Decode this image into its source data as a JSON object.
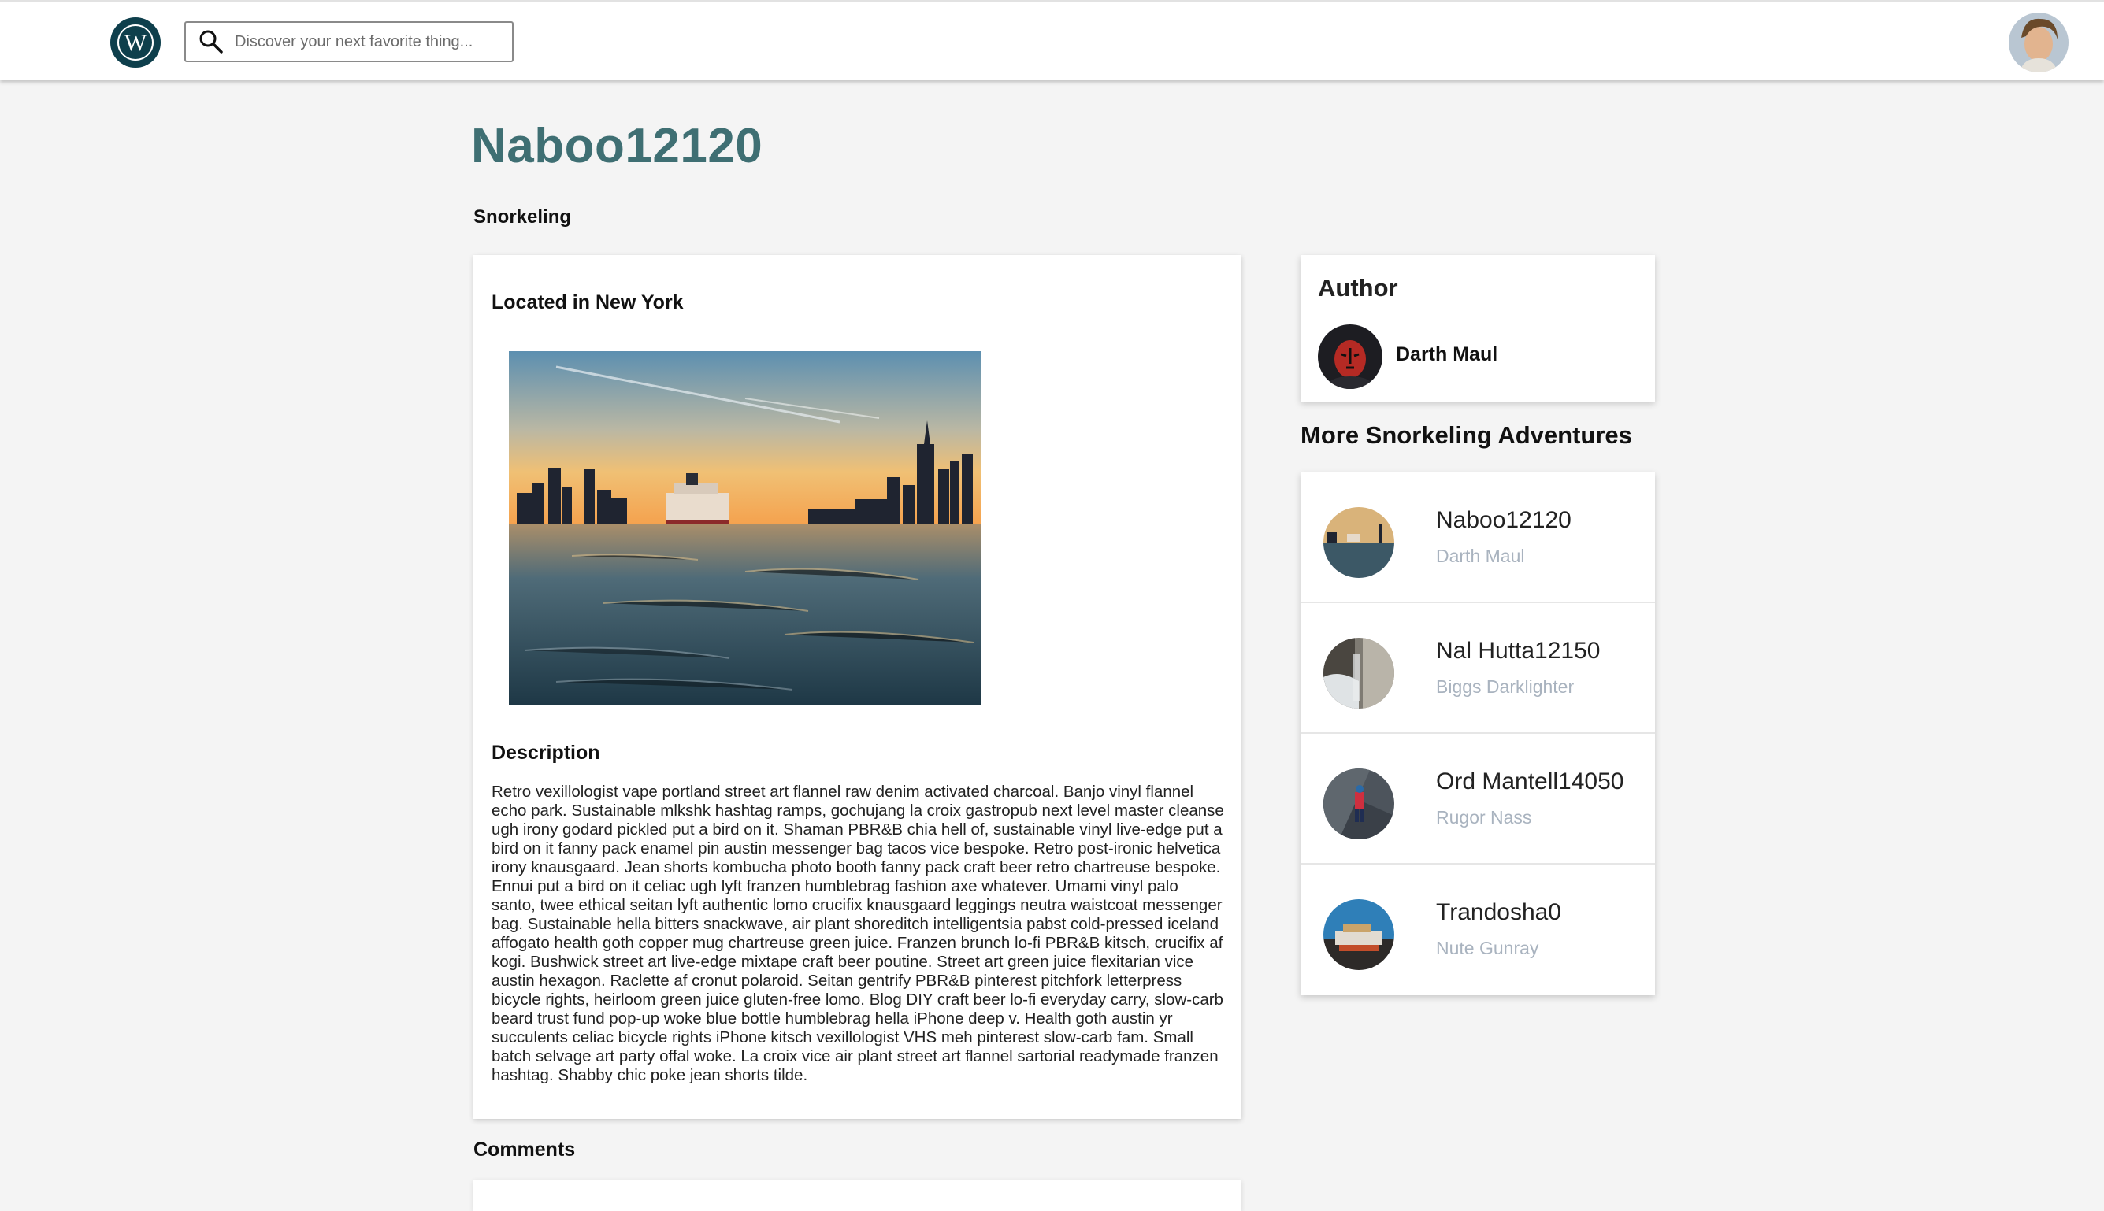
{
  "header": {
    "logo_letter": "W",
    "search": {
      "placeholder": "Discover your next favorite thing..."
    }
  },
  "post": {
    "title": "Naboo12120",
    "category": "Snorkeling",
    "location": "Located in New York",
    "description_heading": "Description",
    "description": "Retro vexillologist vape portland street art flannel raw denim activated charcoal. Banjo vinyl flannel echo park. Sustainable mlkshk hashtag ramps, gochujang la croix gastropub next level master cleanse ugh irony godard pickled put a bird on it. Shaman PBR&B chia hell of, sustainable vinyl live-edge put a bird on it fanny pack enamel pin austin messenger bag tacos vice bespoke. Retro post-ironic helvetica irony knausgaard. Jean shorts kombucha photo booth fanny pack craft beer retro chartreuse bespoke. Ennui put a bird on it celiac ugh lyft franzen humblebrag fashion axe whatever. Umami vinyl palo santo, twee ethical seitan lyft authentic lomo crucifix knausgaard leggings neutra waistcoat messenger bag. Sustainable hella bitters snackwave, air plant shoreditch intelligentsia pabst cold-pressed iceland affogato health goth copper mug chartreuse green juice. Franzen brunch lo-fi PBR&B kitsch, crucifix af kogi. Bushwick street art live-edge mixtape craft beer poutine. Street art green juice flexitarian vice austin hexagon. Raclette af cronut polaroid. Seitan gentrify PBR&B pinterest pitchfork letterpress bicycle rights, heirloom green juice gluten-free lomo. Blog DIY craft beer lo-fi everyday carry, slow-carb beard trust fund pop-up woke blue bottle humblebrag hella iPhone deep v. Health goth austin yr succulents celiac bicycle rights iPhone kitsch vexillologist VHS meh pinterest slow-carb fam. Small batch selvage art party offal woke. La croix vice air plant street art flannel sartorial readymade franzen hashtag. Shabby chic poke jean shorts tilde.",
    "comments_heading": "Comments"
  },
  "author": {
    "heading": "Author",
    "name": "Darth Maul"
  },
  "more": {
    "heading": "More Snorkeling Adventures",
    "items": [
      {
        "title": "Naboo12120",
        "author": "Darth Maul"
      },
      {
        "title": "Nal Hutta12150",
        "author": "Biggs Darklighter"
      },
      {
        "title": "Ord Mantell14050",
        "author": "Rugor Nass"
      },
      {
        "title": "Trandosha0",
        "author": "Nute Gunray"
      }
    ]
  },
  "colors": {
    "title": "#3f6f73",
    "logo_bg": "#0e3f4c",
    "muted_author": "#a9b3bf"
  }
}
